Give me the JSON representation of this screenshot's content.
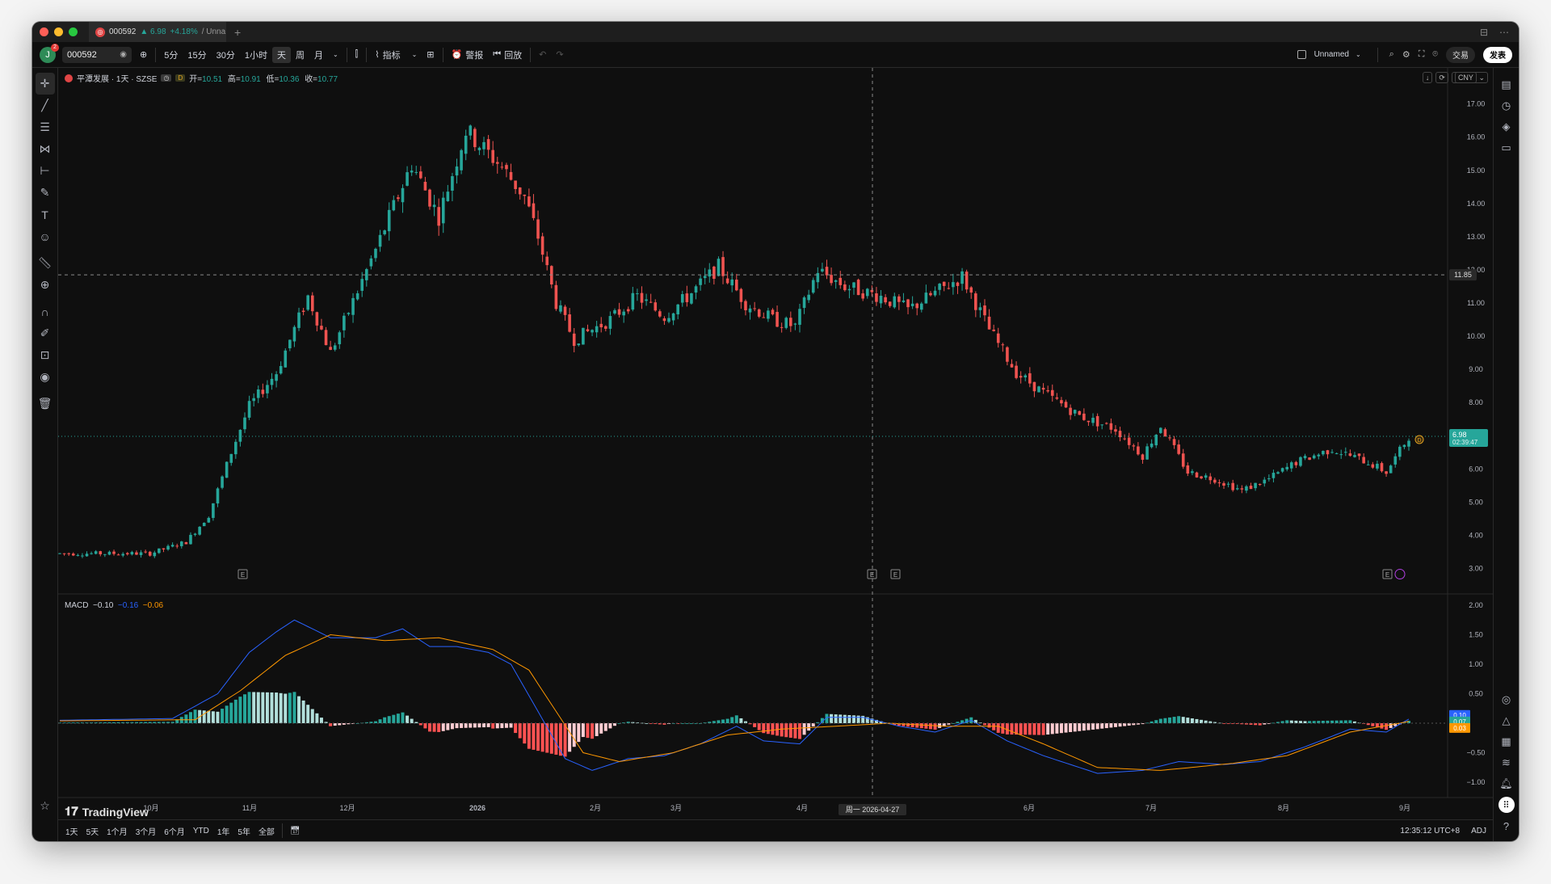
{
  "tab": {
    "symbol": "000592",
    "price": "▲ 6.98",
    "change": "+4.18%",
    "layout": "/ Unna"
  },
  "toolbar": {
    "symbol_value": "000592",
    "avatar_letter": "J",
    "notifications": "2",
    "intervals": [
      "5分",
      "15分",
      "30分",
      "1小时",
      "天",
      "周",
      "月"
    ],
    "active_interval": "天",
    "indicators_label": "指标",
    "alert_label": "警报",
    "replay_label": "回放",
    "layout_name": "Unnamed",
    "trade_label": "交易",
    "publish_label": "发表"
  },
  "legend": {
    "name": "平潭发展 · 1天 · SZSE",
    "d_tag": "D",
    "open_label": "开=",
    "open": "10.51",
    "high_label": "高=",
    "high": "10.91",
    "low_label": "低=",
    "low": "10.36",
    "close_label": "收=",
    "close": "10.77",
    "currency": "CNY"
  },
  "macd_legend": {
    "name": "MACD",
    "hist": "−0.10",
    "macd": "−0.16",
    "signal": "−0.06"
  },
  "crosshair": {
    "price": "11.85",
    "date": "周一 2026-04-27"
  },
  "last_price": {
    "value": "6.98",
    "countdown": "02:39:47"
  },
  "macd_axis_values": {
    "hist": "0.10",
    "macd": "0.07",
    "signal": "0.03"
  },
  "price_axis": [
    "17.00",
    "16.00",
    "15.00",
    "14.00",
    "13.00",
    "12.00",
    "11.00",
    "10.00",
    "9.00",
    "8.00",
    "7.00",
    "6.00",
    "5.00",
    "4.00",
    "3.00"
  ],
  "macd_axis": [
    "2.00",
    "1.50",
    "1.00",
    "0.50",
    "0",
    "−0.50",
    "−1.00"
  ],
  "time_axis": [
    "10月",
    "11月",
    "12月",
    "2026",
    "2月",
    "3月",
    "4月",
    "6月",
    "7月",
    "8月",
    "9月"
  ],
  "bottom": {
    "ranges": [
      "1天",
      "5天",
      "1个月",
      "3个月",
      "6个月",
      "YTD",
      "1年",
      "5年",
      "全部"
    ],
    "clock": "12:35:12 UTC+8",
    "adj": "ADJ"
  },
  "watermark": "TradingView",
  "colors": {
    "up": "#26a69a",
    "down": "#ef5350",
    "macd_line": "#2962ff",
    "signal_line": "#ff9800",
    "bg": "#0f0f0f"
  },
  "chart_data": {
    "type": "candlestick",
    "series": [
      {
        "name": "平潭发展",
        "anchors": [
          {
            "i": 0,
            "p": 3.45
          },
          {
            "i": 20,
            "p": 3.45
          },
          {
            "i": 28,
            "p": 3.8
          },
          {
            "i": 33,
            "p": 4.6
          },
          {
            "i": 38,
            "p": 6.5
          },
          {
            "i": 42,
            "p": 7.9
          },
          {
            "i": 48,
            "p": 8.9
          },
          {
            "i": 55,
            "p": 11.2
          },
          {
            "i": 60,
            "p": 9.5
          },
          {
            "i": 70,
            "p": 12.6
          },
          {
            "i": 78,
            "p": 15.2
          },
          {
            "i": 84,
            "p": 13.6
          },
          {
            "i": 90,
            "p": 16.2
          },
          {
            "i": 98,
            "p": 15.1
          },
          {
            "i": 103,
            "p": 14.2
          },
          {
            "i": 106,
            "p": 13.0
          },
          {
            "i": 110,
            "p": 11.0
          },
          {
            "i": 114,
            "p": 9.9
          },
          {
            "i": 122,
            "p": 10.5
          },
          {
            "i": 128,
            "p": 11.2
          },
          {
            "i": 134,
            "p": 10.6
          },
          {
            "i": 140,
            "p": 11.3
          },
          {
            "i": 146,
            "p": 12.1
          },
          {
            "i": 152,
            "p": 11.0
          },
          {
            "i": 158,
            "p": 10.5
          },
          {
            "i": 163,
            "p": 10.3
          },
          {
            "i": 168,
            "p": 12.0
          },
          {
            "i": 174,
            "p": 11.5
          },
          {
            "i": 182,
            "p": 11.2
          },
          {
            "i": 188,
            "p": 10.8
          },
          {
            "i": 194,
            "p": 11.3
          },
          {
            "i": 200,
            "p": 11.8
          },
          {
            "i": 206,
            "p": 10.2
          },
          {
            "i": 212,
            "p": 8.9
          },
          {
            "i": 218,
            "p": 8.3
          },
          {
            "i": 226,
            "p": 7.6
          },
          {
            "i": 234,
            "p": 7.2
          },
          {
            "i": 240,
            "p": 6.4
          },
          {
            "i": 244,
            "p": 7.3
          },
          {
            "i": 250,
            "p": 5.9
          },
          {
            "i": 256,
            "p": 5.7
          },
          {
            "i": 262,
            "p": 5.35
          },
          {
            "i": 268,
            "p": 5.7
          },
          {
            "i": 274,
            "p": 6.2
          },
          {
            "i": 282,
            "p": 6.6
          },
          {
            "i": 290,
            "p": 6.2
          },
          {
            "i": 294,
            "p": 5.9
          },
          {
            "i": 299,
            "p": 6.98
          }
        ]
      }
    ],
    "macd": {
      "name": "MACD",
      "macd_anchors": [
        {
          "i": 0,
          "v": 0.05
        },
        {
          "i": 25,
          "v": 0.08
        },
        {
          "i": 35,
          "v": 0.5
        },
        {
          "i": 42,
          "v": 1.2
        },
        {
          "i": 48,
          "v": 1.55
        },
        {
          "i": 52,
          "v": 1.75
        },
        {
          "i": 60,
          "v": 1.45
        },
        {
          "i": 70,
          "v": 1.45
        },
        {
          "i": 76,
          "v": 1.6
        },
        {
          "i": 82,
          "v": 1.3
        },
        {
          "i": 88,
          "v": 1.3
        },
        {
          "i": 95,
          "v": 1.2
        },
        {
          "i": 100,
          "v": 1.0
        },
        {
          "i": 106,
          "v": 0.2
        },
        {
          "i": 112,
          "v": -0.6
        },
        {
          "i": 118,
          "v": -0.8
        },
        {
          "i": 126,
          "v": -0.6
        },
        {
          "i": 134,
          "v": -0.55
        },
        {
          "i": 142,
          "v": -0.35
        },
        {
          "i": 150,
          "v": -0.05
        },
        {
          "i": 156,
          "v": -0.3
        },
        {
          "i": 164,
          "v": -0.35
        },
        {
          "i": 170,
          "v": 0.1
        },
        {
          "i": 178,
          "v": 0.1
        },
        {
          "i": 186,
          "v": -0.05
        },
        {
          "i": 194,
          "v": -0.15
        },
        {
          "i": 202,
          "v": 0.05
        },
        {
          "i": 210,
          "v": -0.3
        },
        {
          "i": 218,
          "v": -0.55
        },
        {
          "i": 230,
          "v": -0.85
        },
        {
          "i": 240,
          "v": -0.8
        },
        {
          "i": 248,
          "v": -0.65
        },
        {
          "i": 258,
          "v": -0.7
        },
        {
          "i": 266,
          "v": -0.65
        },
        {
          "i": 276,
          "v": -0.4
        },
        {
          "i": 286,
          "v": -0.1
        },
        {
          "i": 294,
          "v": -0.15
        },
        {
          "i": 299,
          "v": 0.07
        }
      ],
      "signal_anchors": [
        {
          "i": 0,
          "v": 0.04
        },
        {
          "i": 30,
          "v": 0.06
        },
        {
          "i": 40,
          "v": 0.55
        },
        {
          "i": 50,
          "v": 1.15
        },
        {
          "i": 60,
          "v": 1.5
        },
        {
          "i": 72,
          "v": 1.4
        },
        {
          "i": 84,
          "v": 1.45
        },
        {
          "i": 96,
          "v": 1.25
        },
        {
          "i": 104,
          "v": 0.9
        },
        {
          "i": 110,
          "v": 0.2
        },
        {
          "i": 116,
          "v": -0.5
        },
        {
          "i": 124,
          "v": -0.65
        },
        {
          "i": 136,
          "v": -0.5
        },
        {
          "i": 148,
          "v": -0.2
        },
        {
          "i": 160,
          "v": -0.1
        },
        {
          "i": 172,
          "v": -0.05
        },
        {
          "i": 184,
          "v": 0.0
        },
        {
          "i": 196,
          "v": -0.05
        },
        {
          "i": 208,
          "v": -0.05
        },
        {
          "i": 218,
          "v": -0.35
        },
        {
          "i": 230,
          "v": -0.75
        },
        {
          "i": 244,
          "v": -0.8
        },
        {
          "i": 260,
          "v": -0.68
        },
        {
          "i": 272,
          "v": -0.55
        },
        {
          "i": 286,
          "v": -0.15
        },
        {
          "i": 299,
          "v": 0.03
        }
      ]
    },
    "price_range": [
      2.5,
      17.6
    ],
    "macd_range": [
      -1.15,
      2.0
    ],
    "bar_count": 300
  }
}
